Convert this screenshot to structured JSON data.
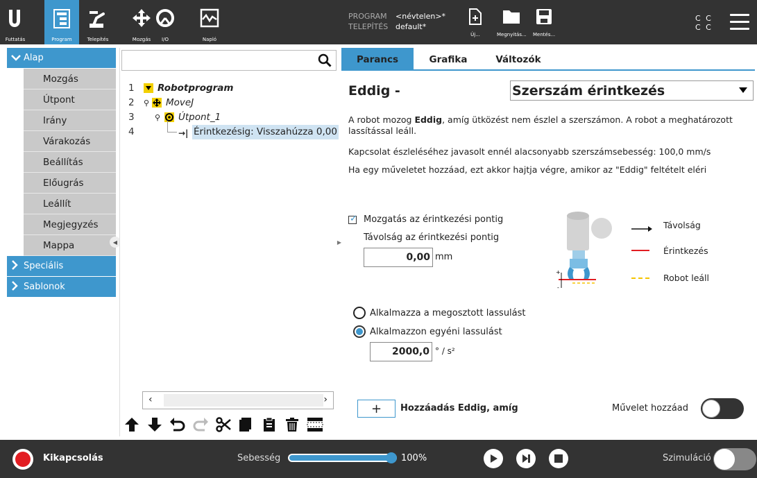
{
  "nav": {
    "run": "Futtatás",
    "program": "Program",
    "installation": "Telepítés",
    "move": "Mozgás",
    "io": "I/O",
    "log": "Napló"
  },
  "program_info": {
    "program_key": "PROGRAM",
    "program_value": "<névtelen>*",
    "install_key": "TELEPÍTÉS",
    "install_value": "default*"
  },
  "file": {
    "new": "Új...",
    "open": "Megnyitás...",
    "save": "Mentés..."
  },
  "cc": {
    "line1": "C C",
    "line2": "C C"
  },
  "left_panel": {
    "category_basic": "Alap",
    "items": [
      "Mozgás",
      "Útpont",
      "Irány",
      "Várakozás",
      "Beállítás",
      "Előugrás",
      "Leállít",
      "Megjegyzés",
      "Mappa"
    ],
    "category_special": "Speciális",
    "category_templates": "Sablonok"
  },
  "tree": {
    "rows": [
      {
        "num": "1",
        "text": "Robotprogram"
      },
      {
        "num": "2",
        "text": "MoveJ"
      },
      {
        "num": "3",
        "text": "Útpont_1"
      },
      {
        "num": "4",
        "text": "Érintkezésig: Visszahúzza 0,00"
      }
    ]
  },
  "tabs": {
    "command": "Parancs",
    "graphics": "Grafika",
    "variables": "Változók"
  },
  "command": {
    "heading": "Eddig -",
    "dropdown_value": "Szerszám érintkezés",
    "desc1_a": "A robot mozog ",
    "desc1_b": "Eddig",
    "desc1_c": ", amíg ütközést nem észlel a szerszámon. A robot a meghatározott lassítással leáll.",
    "desc2": "Kapcsolat észleléséhez javasolt ennél alacsonyabb szerszámsebesség: 100,0 mm/s",
    "desc3": "Ha egy műveletet hozzáad, ezt akkor hajtja végre, amikor az \"Eddig\" feltételt eléri",
    "checkbox_label": "Mozgatás az érintkezési pontig",
    "distance_label": "Távolság az érintkezési pontig",
    "distance_value": "0,00",
    "distance_unit": "mm",
    "radio_shared": "Alkalmazza a megosztott lassulást",
    "radio_custom": "Alkalmazzon egyéni lassulást",
    "decel_value": "2000,0",
    "decel_unit": "° / s²",
    "legend_distance": "Távolság",
    "legend_contact": "Érintkezés",
    "legend_stop": "Robot leáll",
    "add_plus": "+",
    "add_label": "Hozzáadás Eddig, amíg",
    "action_label": "Művelet hozzáad"
  },
  "bottom": {
    "power_label": "Kikapcsolás",
    "speed_label": "Sebesség",
    "speed_value": "100%",
    "speed_fraction": 1.0,
    "sim_label": "Szimuláció"
  },
  "colors": {
    "accent": "#3e97cd",
    "topbar": "#333333",
    "power_red": "#e21d22",
    "contact_red": "#e21d22",
    "stop_yellow": "#f5c400"
  }
}
